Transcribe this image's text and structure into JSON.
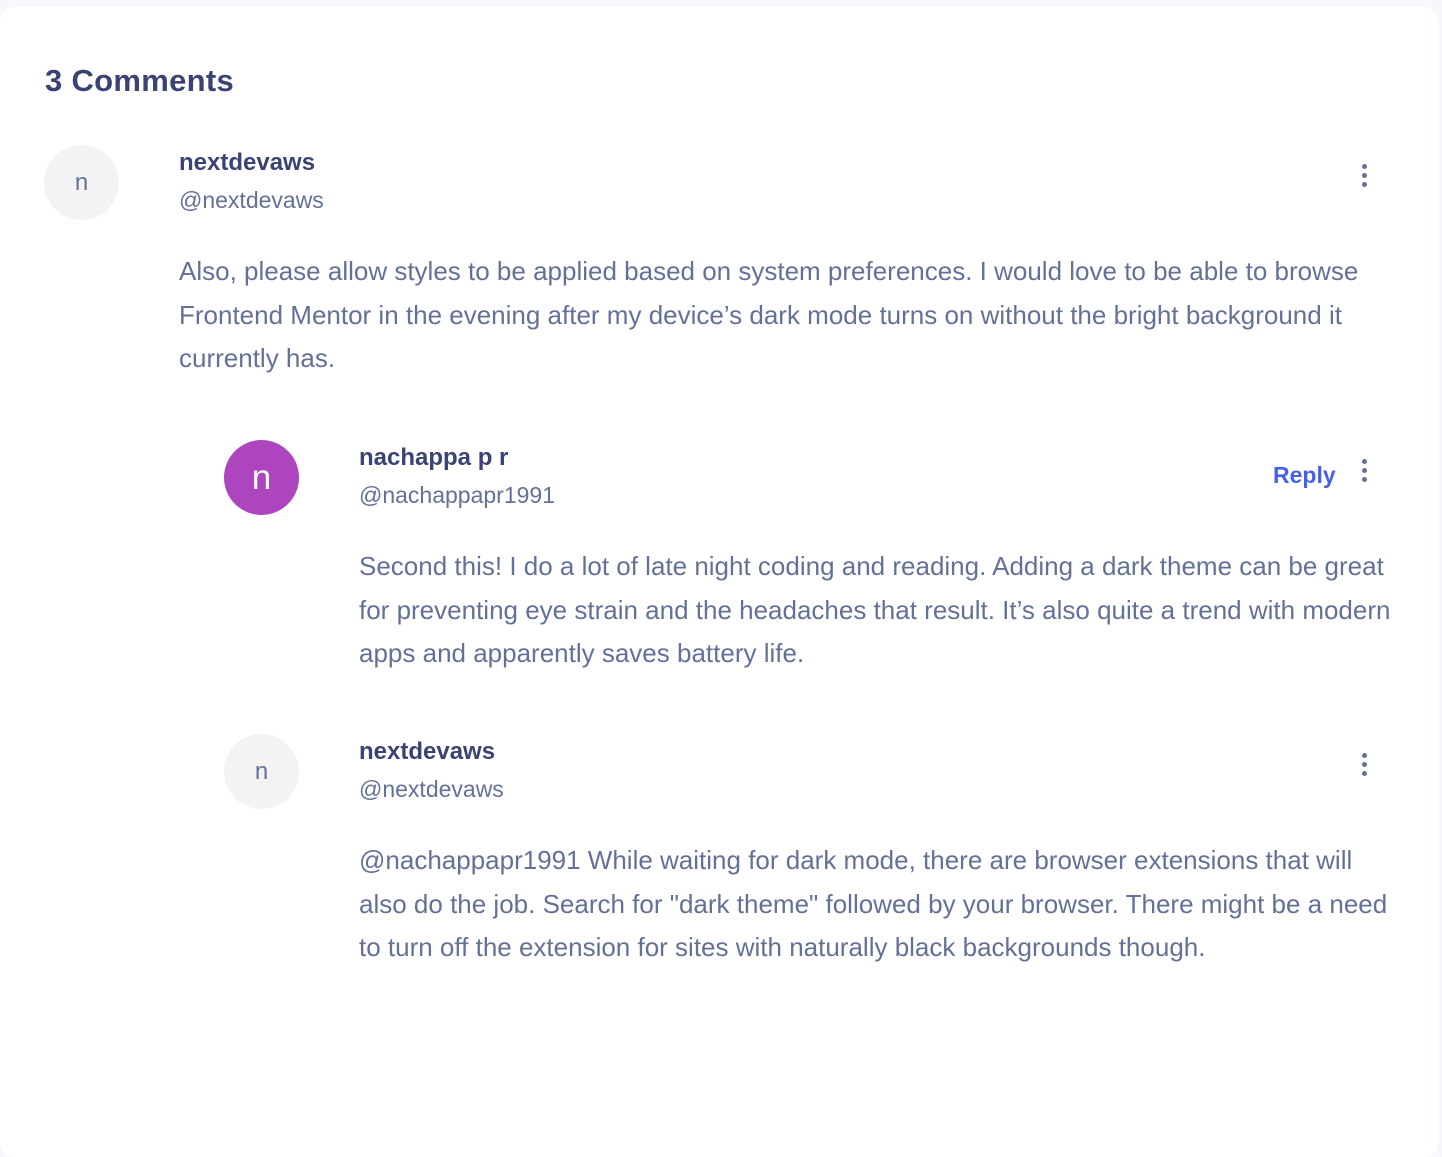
{
  "section": {
    "heading": "3 Comments"
  },
  "comments": [
    {
      "avatar_initial": "n",
      "name": "nextdevaws",
      "handle": "@nextdevaws",
      "body": "Also, please allow styles to be applied based on system preferences. I would love to be able to browse Frontend Mentor in the evening after my device’s dark mode turns on without the bright background it currently has."
    },
    {
      "avatar_initial": "n",
      "avatar_color": "#ad45be",
      "name": "nachappa p r",
      "handle": "@nachappapr1991",
      "reply_label": "Reply",
      "body": "Second this! I do a lot of late night coding and reading. Adding a dark theme can be great for preventing eye strain and the headaches that result. It’s also quite a trend with modern apps and apparently saves battery life."
    },
    {
      "avatar_initial": "n",
      "name": "nextdevaws",
      "handle": "@nextdevaws",
      "body": "@nachappapr1991 While waiting for dark mode, there are browser extensions that will also do the job. Search for \"dark theme\" followed by your browser. There might be a need to turn off the extension for sites with naturally black backgrounds though."
    }
  ],
  "colors": {
    "heading": "#3a4374",
    "text": "#647196",
    "accent": "#4661e6",
    "avatar_purple": "#ad45be"
  },
  "icons": {
    "more_menu": "vertical-ellipsis-icon"
  }
}
